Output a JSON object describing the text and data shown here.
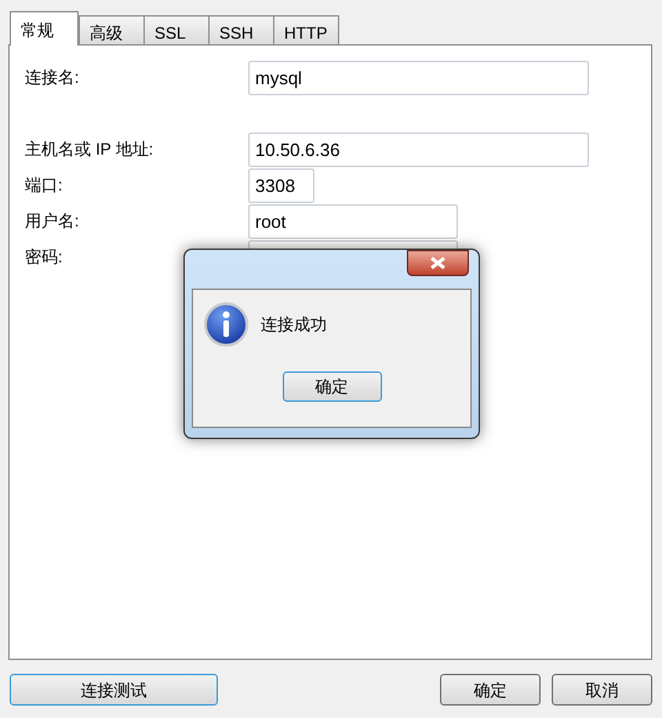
{
  "tabs": [
    {
      "label": "常规",
      "selected": true
    },
    {
      "label": "高级",
      "selected": false
    },
    {
      "label": "SSL",
      "selected": false
    },
    {
      "label": "SSH",
      "selected": false
    },
    {
      "label": "HTTP",
      "selected": false
    }
  ],
  "fields": [
    {
      "label": "连接名:",
      "value": "mysql",
      "kind": "wide"
    },
    {
      "label": "主机名或 IP 地址:",
      "value": "10.50.6.36",
      "kind": "wide"
    },
    {
      "label": "端口:",
      "value": "3308",
      "kind": "short"
    },
    {
      "label": "用户名:",
      "value": "root",
      "kind": "medium"
    },
    {
      "label": "密码:",
      "kind": "password"
    }
  ],
  "dialog": {
    "message": "连接成功",
    "button": "确定"
  },
  "buttons": {
    "test": "连接测试",
    "ok": "确定",
    "cancel": "取消"
  }
}
